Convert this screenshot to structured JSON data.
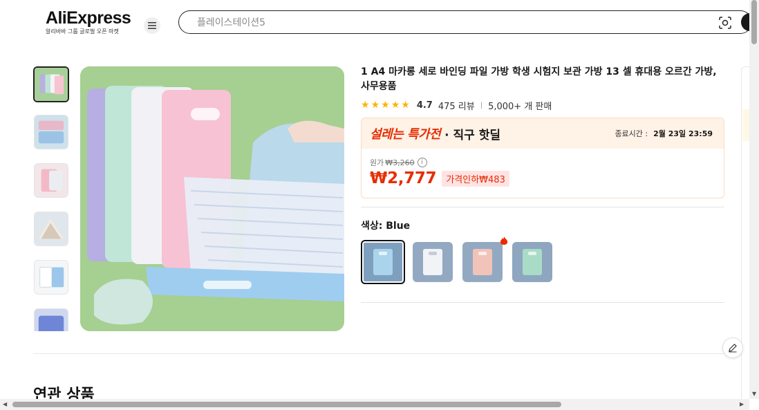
{
  "header": {
    "logo_text": "AliExpress",
    "logo_sub": "알리바바 그룹 글로벌 오픈 마켓",
    "search_placeholder": "플레이스테이션5"
  },
  "product": {
    "title": "1 A4 마카롱 세로 바인딩 파일 가방 학생 시험지 보관 가방 13 셀 휴대용 오르간 가방, 사무용품",
    "rating": "4.7",
    "reviews": "475 리뷰",
    "sold": "5,000+ 개 판매",
    "stars": 5
  },
  "deal": {
    "title": "설레는 특가전",
    "subtitle": "· 직구 핫딜",
    "end_label": "종료시간 :",
    "end_time": "2월 23일 23:59",
    "orig_label": "원가",
    "orig_price": "₩3,260",
    "price": "₩2,777",
    "discount": "가격인하₩483"
  },
  "variants": {
    "label": "색상: Blue",
    "items": [
      {
        "name": "Blue",
        "color": "#8ba9c6",
        "selected": true
      },
      {
        "name": "White",
        "color": "#b9c2d0",
        "selected": false
      },
      {
        "name": "Pink",
        "color": "#a9b4c8",
        "selected": false,
        "hot": true
      },
      {
        "name": "Green",
        "color": "#8fa9c0",
        "selected": false
      }
    ]
  },
  "related": {
    "title": "연관 상품"
  },
  "colors": {
    "brand_red": "#e62e04",
    "star": "#fdb400",
    "deal_bg": "#fff2e6"
  }
}
